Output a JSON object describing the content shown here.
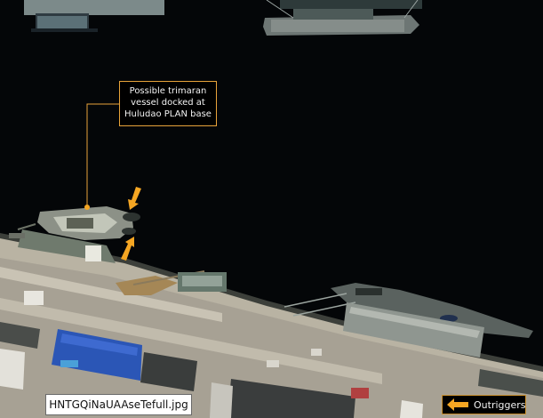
{
  "annotation": {
    "callout_text": "Possible trimaran\nvessel docked at\nHuludao PLAN base"
  },
  "image_label": {
    "filename": "HNTGQiNaUAAseTefull.jpg"
  },
  "legend": {
    "label": "Outriggers",
    "icon": "left-arrow-icon"
  },
  "colors": {
    "water": "#040608",
    "accent": "#f5a623",
    "callout_border": "#e8a33a"
  }
}
